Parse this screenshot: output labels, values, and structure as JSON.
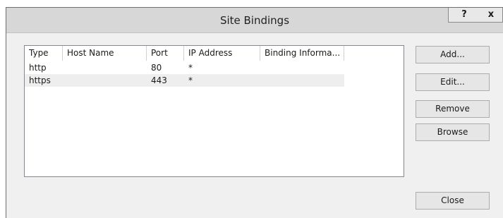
{
  "dialog": {
    "title": "Site Bindings",
    "help_label": "?",
    "close_label": "x"
  },
  "table": {
    "columns": [
      "Type",
      "Host Name",
      "Port",
      "IP Address",
      "Binding Informa..."
    ],
    "rows": [
      [
        "http",
        "",
        "80",
        "*",
        ""
      ],
      [
        "https",
        "",
        "443",
        "*",
        ""
      ]
    ]
  },
  "buttons": {
    "add": "Add...",
    "edit": "Edit...",
    "remove": "Remove",
    "browse": "Browse",
    "close": "Close"
  }
}
